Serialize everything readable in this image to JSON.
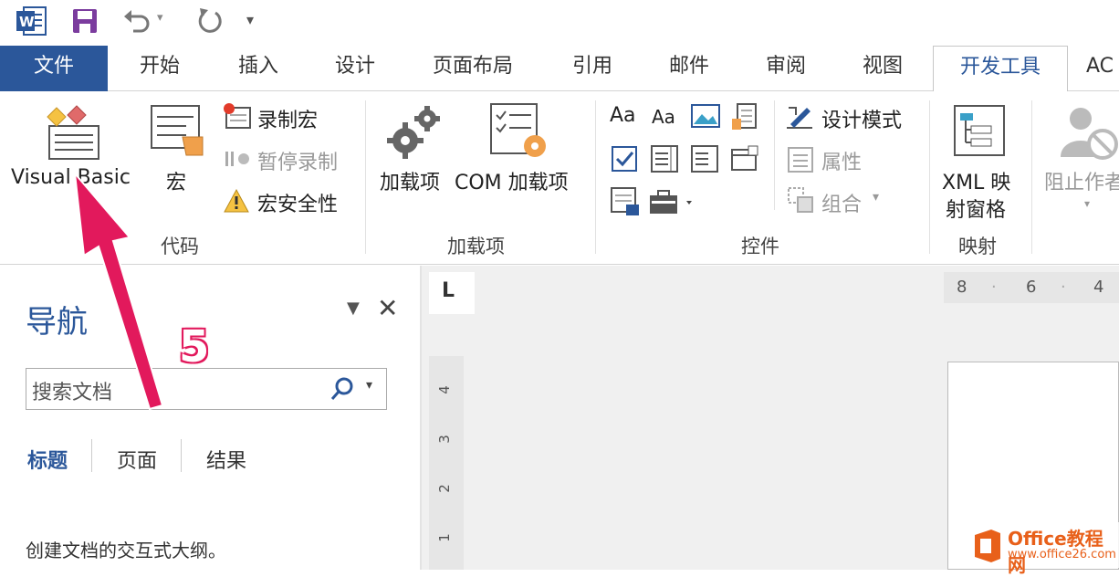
{
  "tabs": {
    "file": "文件",
    "home": "开始",
    "insert": "插入",
    "design": "设计",
    "layout": "页面布局",
    "references": "引用",
    "mailings": "邮件",
    "review": "审阅",
    "view": "视图",
    "developer": "开发工具",
    "acrobat": "AC"
  },
  "ribbon": {
    "code": {
      "visual_basic": "Visual Basic",
      "macros": "宏",
      "record_macro": "录制宏",
      "pause_recording": "暂停录制",
      "macro_security": "宏安全性",
      "label": "代码"
    },
    "addins": {
      "addins": "加载项",
      "com_addins": "COM 加载项",
      "label": "加载项"
    },
    "controls": {
      "design_mode": "设计模式",
      "properties": "属性",
      "group": "组合",
      "label": "控件",
      "aa1": "Aa",
      "aa2": "Aa"
    },
    "mapping": {
      "xml_line1": "XML 映",
      "xml_line2": "射窗格",
      "label": "映射"
    },
    "protect": {
      "block_authors": "阻止作者"
    }
  },
  "nav": {
    "title": "导航",
    "close": "✕",
    "search_placeholder": "搜索文档",
    "tabs": [
      "标题",
      "页面",
      "结果"
    ],
    "hint": "创建文档的交互式大纲。"
  },
  "rulers": {
    "horizontal": [
      "8",
      "6",
      "4"
    ],
    "vertical": [
      "4",
      "3",
      "2",
      "1"
    ]
  },
  "annotation": {
    "step": "5"
  },
  "watermark": {
    "line1": "Office教程网",
    "line2": "www.office26.com"
  },
  "colors": {
    "accent": "#2b579a",
    "arrow": "#e2195c"
  }
}
